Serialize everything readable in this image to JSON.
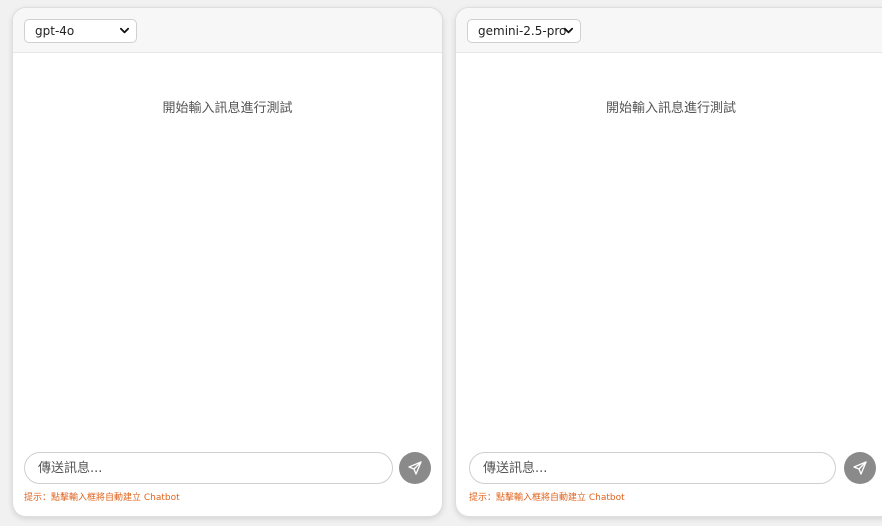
{
  "panels": [
    {
      "model": "gpt-4o",
      "empty_message": "開始輸入訊息進行測試",
      "input_placeholder": "傳送訊息...",
      "hint": "提示：點擊輸入框將自動建立 Chatbot"
    },
    {
      "model": "gemini-2.5-pro",
      "empty_message": "開始輸入訊息進行測試",
      "input_placeholder": "傳送訊息...",
      "hint": "提示：點擊輸入框將自動建立 Chatbot"
    }
  ],
  "colors": {
    "hint": "#e0641e",
    "send_button": "#8a8a8a",
    "page_background": "#f1f1f1"
  },
  "icons": {
    "select": "chevron-down-icon",
    "send": "send-icon"
  }
}
